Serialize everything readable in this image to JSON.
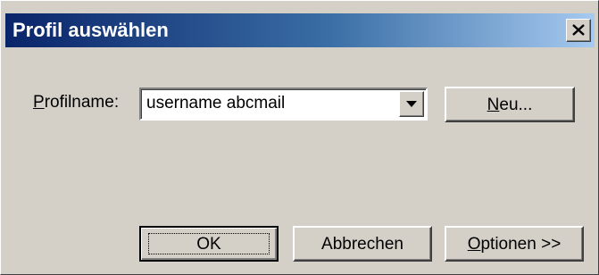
{
  "dialog": {
    "title": "Profil auswählen",
    "close_icon": "close-x-icon"
  },
  "profile": {
    "label_mnemonic": "P",
    "label_rest": "rofilname:",
    "selected_value": "username abcmail",
    "dropdown_icon": "chevron-down-icon"
  },
  "buttons": {
    "neu_mnemonic": "N",
    "neu_rest": "eu...",
    "ok": "OK",
    "abbrechen": "Abbrechen",
    "optionen_mnemonic": "O",
    "optionen_rest": "ptionen >>"
  },
  "colors": {
    "face": "#d4d0c8",
    "title_start": "#0a246a",
    "title_end": "#a6caf0",
    "title_text": "#ffffff"
  }
}
